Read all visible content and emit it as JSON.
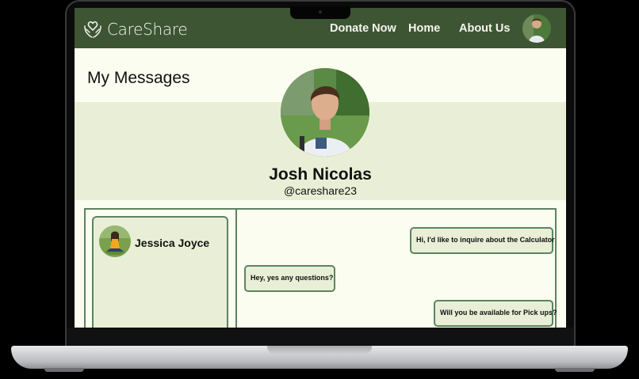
{
  "app": {
    "brand": "CareShare"
  },
  "nav": {
    "donate": "Donate Now",
    "home": "Home",
    "about": "About Us"
  },
  "page": {
    "title": "My Messages"
  },
  "profile": {
    "name": "Josh Nicolas",
    "handle": "@careshare23"
  },
  "contacts": [
    {
      "name": "Jessica Joyce"
    }
  ],
  "messages": [
    {
      "from": "me",
      "text": "Hi, I'd like to inquire about the Calculator"
    },
    {
      "from": "them",
      "text": "Hey, yes any questions?"
    },
    {
      "from": "me",
      "text": "Will you be available for Pick ups?"
    }
  ],
  "colors": {
    "nav": "#3e5534",
    "band": "#e8efd6",
    "border": "#5d8360",
    "page": "#fbfdf0"
  }
}
